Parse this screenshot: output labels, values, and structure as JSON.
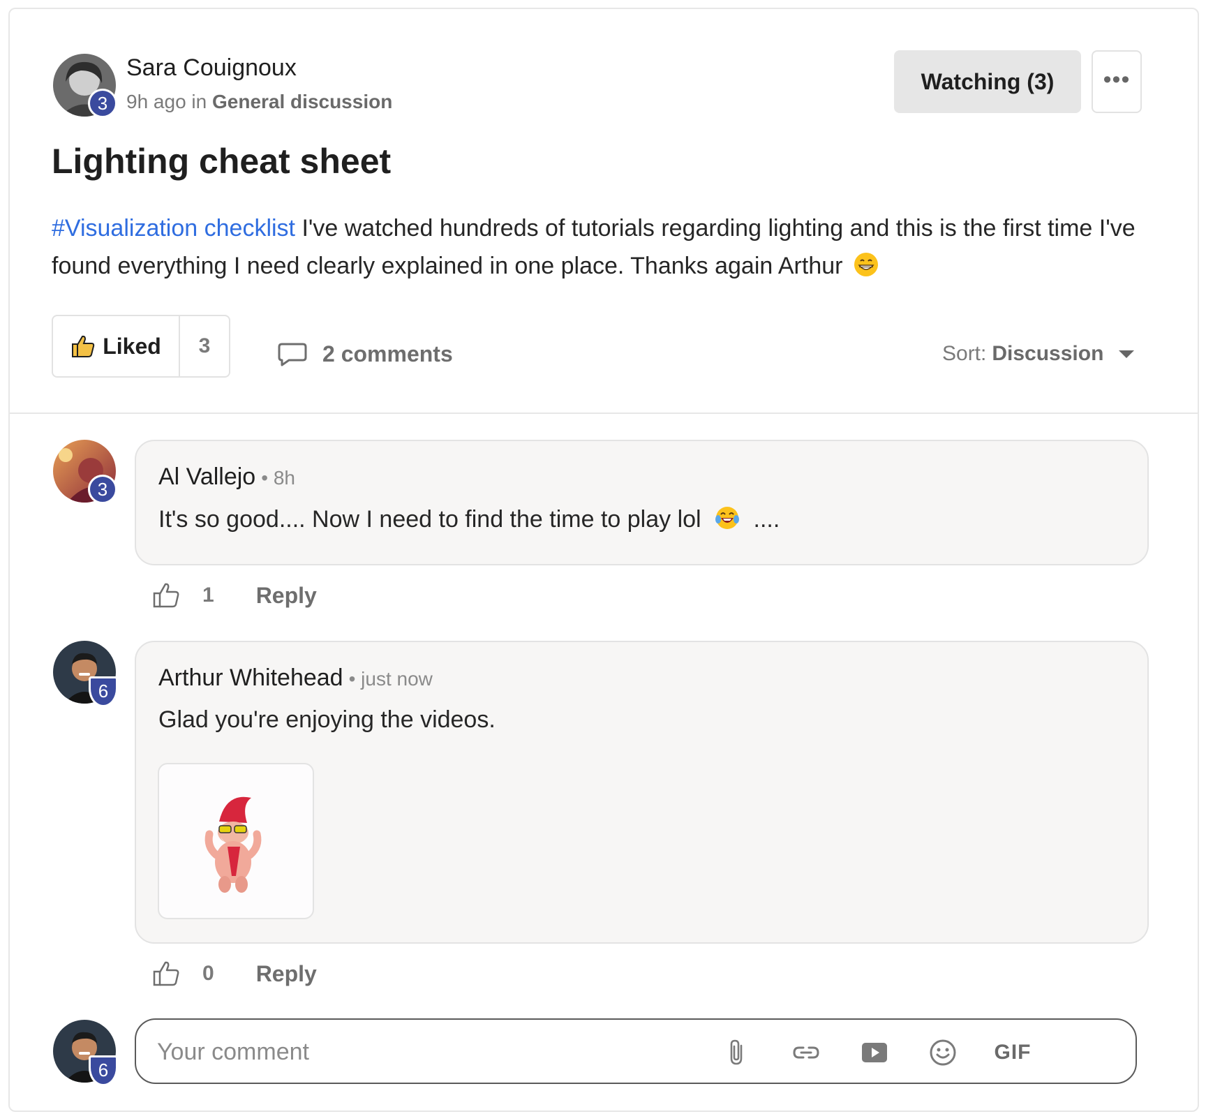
{
  "post": {
    "author": "Sara Couignoux",
    "author_level": "3",
    "time": "9h ago",
    "in_word": "in",
    "category": "General discussion",
    "watch_label": "Watching (3)",
    "more_label": "•••",
    "title": "Lighting cheat sheet",
    "hashtag": "#Visualization checklist",
    "body": " I've watched hundreds of tutorials regarding lighting and this is the first time I've found everything I need clearly explained in one place. Thanks again Arthur",
    "body_emoji": "grinning-face-emoji",
    "liked_label": "Liked",
    "like_count": "3",
    "comments_label": "2 comments",
    "sort_prefix": "Sort:",
    "sort_value": "Discussion"
  },
  "comments": [
    {
      "author": "Al Vallejo",
      "level": "3",
      "time": "• 8h",
      "text": "It's so good.... Now I need to find the time to play lol",
      "text_suffix": "....",
      "emoji": "tears-of-joy-emoji",
      "likes": "1",
      "reply_label": "Reply"
    },
    {
      "author": "Arthur Whitehead",
      "level": "6",
      "time": "• just now",
      "text": "Glad you're enjoying the videos.",
      "attachment": "dancing-gnome-gif",
      "likes": "0",
      "reply_label": "Reply"
    }
  ],
  "composer": {
    "placeholder": "Your comment",
    "user_level": "6",
    "gif_label": "GIF"
  },
  "colors": {
    "link": "#2f6de0",
    "badge": "#3a4a9e",
    "bubble": "#f7f6f5",
    "watch_bg": "#e6e6e6"
  }
}
